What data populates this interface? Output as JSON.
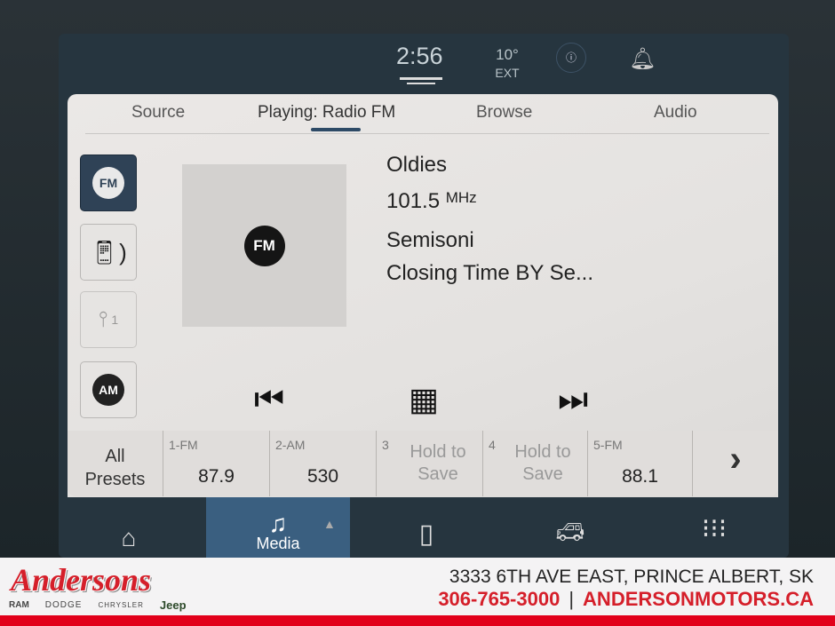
{
  "status": {
    "time": "2:56",
    "temperature": "10°",
    "temp_label": "EXT"
  },
  "tabs": [
    {
      "label": "Source"
    },
    {
      "label": "Playing: Radio FM"
    },
    {
      "label": "Browse"
    },
    {
      "label": "Audio"
    }
  ],
  "sources": [
    {
      "label": "FM"
    },
    {
      "label": "Bluetooth"
    },
    {
      "label": "1"
    },
    {
      "label": "AM"
    }
  ],
  "now_playing": {
    "art_label": "FM",
    "genre": "Oldies",
    "frequency": "101.5",
    "unit": "MHz",
    "artist": "Semisoni",
    "title": "Closing Time BY Se..."
  },
  "presets": {
    "all_label": "All Presets",
    "items": [
      {
        "num": "1-FM",
        "value": "87.9"
      },
      {
        "num": "2-AM",
        "value": "530"
      },
      {
        "num": "3",
        "value": "Hold to Save"
      },
      {
        "num": "4",
        "value": "Hold to Save"
      },
      {
        "num": "5-FM",
        "value": "88.1"
      }
    ]
  },
  "bottom_nav": {
    "media_label": "Media"
  },
  "banner": {
    "logo": "Andersons",
    "brands": [
      "RAM",
      "DODGE",
      "CHRYSLER",
      "Jeep"
    ],
    "address": "3333 6TH AVE EAST, PRINCE ALBERT, SK",
    "phone": "306-765-3000",
    "website": "ANDERSONMOTORS.CA"
  },
  "colors": {
    "accent": "#2f4256",
    "brand_red": "#d51f2a"
  }
}
